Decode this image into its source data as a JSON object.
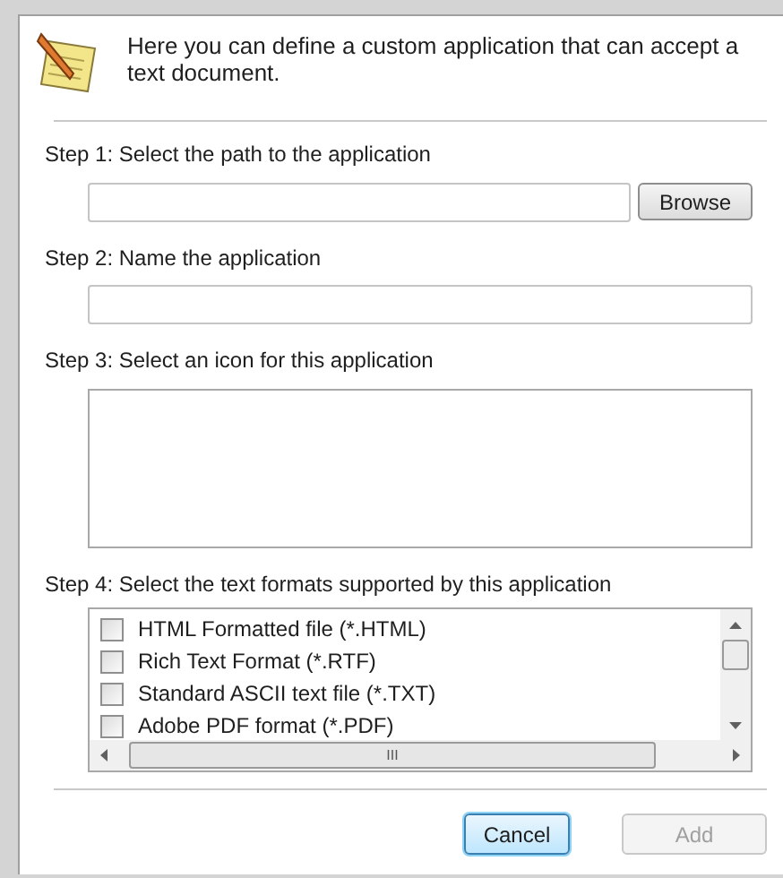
{
  "header": {
    "text": "Here you can define a custom application that can accept a text document."
  },
  "step1": {
    "label": "Step 1: Select the path to the application",
    "browse": "Browse"
  },
  "step2": {
    "label": "Step 2: Name the application"
  },
  "step3": {
    "label": "Step 3: Select an icon for this application"
  },
  "step4": {
    "label": "Step 4: Select the text formats supported by this application",
    "formats": [
      {
        "label": "HTML Formatted file (*.HTML)",
        "checked": false
      },
      {
        "label": "Rich Text Format (*.RTF)",
        "checked": false
      },
      {
        "label": "Standard ASCII text file (*.TXT)",
        "checked": false
      },
      {
        "label": "Adobe PDF format (*.PDF)",
        "checked": false
      }
    ],
    "scroll_thumb_label": "III"
  },
  "buttons": [
    {
      "label": "Cancel",
      "disabled": false,
      "default": true
    },
    {
      "label": "Add",
      "disabled": true,
      "default": false
    }
  ]
}
